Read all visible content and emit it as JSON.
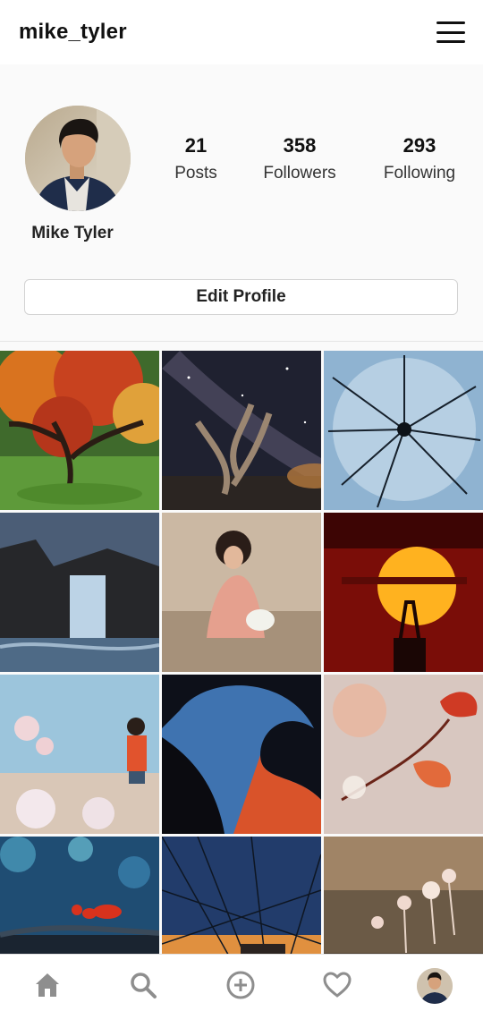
{
  "header": {
    "username": "mike_tyler",
    "menu_icon": "hamburger-menu-icon"
  },
  "profile": {
    "display_name": "Mike Tyler",
    "avatar": "profile-photo-man-denim-jacket",
    "stats": [
      {
        "value": "21",
        "label": "Posts"
      },
      {
        "value": "358",
        "label": "Followers"
      },
      {
        "value": "293",
        "label": "Following"
      }
    ],
    "edit_button_label": "Edit Profile"
  },
  "posts": [
    "autumn-maple-tree",
    "milky-way-dead-tree",
    "frozen-dandelion-seed",
    "night-waterfall",
    "woman-in-pink-dress-flowers",
    "sunset-behind-tower",
    "woman-on-rocks-blossoms",
    "antelope-canyon-arch",
    "red-autumn-leaves-branch",
    "red-ant-on-twig-bokeh",
    "bridge-cables-at-sunset",
    "tiny-mushrooms-bokeh"
  ],
  "bottom_nav": [
    {
      "icon": "home-icon"
    },
    {
      "icon": "search-icon"
    },
    {
      "icon": "add-post-icon"
    },
    {
      "icon": "heart-icon"
    },
    {
      "icon": "profile-avatar"
    }
  ],
  "colors": {
    "background": "#fafafa",
    "bar": "#ffffff",
    "text": "#262626",
    "icon": "#8e8e8e"
  }
}
